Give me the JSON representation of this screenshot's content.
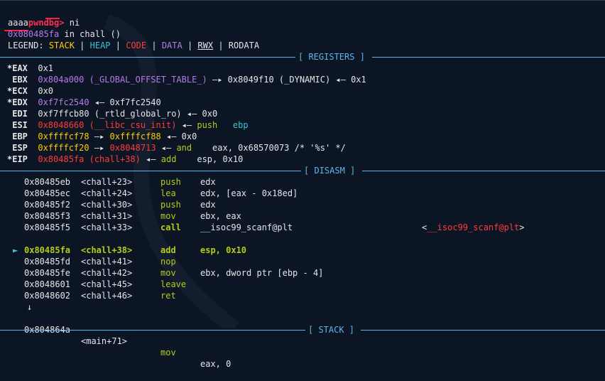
{
  "prompt": "pwndbg>",
  "command": "ni",
  "output_line": "aaaa",
  "location": {
    "addr": "0x080485fa",
    "text": " in chall ()"
  },
  "legend": {
    "label": "LEGEND:",
    "stack": "STACK",
    "heap": "HEAP",
    "code": "CODE",
    "data": "DATA",
    "rwx": "RWX",
    "rodata": "RODATA",
    "sep": " | "
  },
  "sections": {
    "registers": "[ REGISTERS ]",
    "disasm": "[ DISASM ]",
    "stack": "[ STACK ]"
  },
  "registers": [
    {
      "mark": "*",
      "name": "EAX",
      "parts": [
        {
          "t": "0x1",
          "c": "plain"
        }
      ]
    },
    {
      "mark": " ",
      "name": "EBX",
      "parts": [
        {
          "t": "0x804a000 (_GLOBAL_OFFSET_TABLE_)",
          "c": "purple"
        },
        {
          "t": " —▸ 0x8049f10 (_DYNAMIC) ◂— 0x1",
          "c": "plain"
        }
      ]
    },
    {
      "mark": "*",
      "name": "ECX",
      "parts": [
        {
          "t": "0x0",
          "c": "plain"
        }
      ]
    },
    {
      "mark": "*",
      "name": "EDX",
      "parts": [
        {
          "t": "0xf7fc2540",
          "c": "purple"
        },
        {
          "t": " ◂— 0xf7fc2540",
          "c": "plain"
        }
      ]
    },
    {
      "mark": " ",
      "name": "EDI",
      "parts": [
        {
          "t": "0xf7ffcb80 (_rtld_global_ro) ◂— 0x0",
          "c": "plain"
        }
      ]
    },
    {
      "mark": " ",
      "name": "ESI",
      "parts": [
        {
          "t": "0x8048660 (__libc_csu_init)",
          "c": "red"
        },
        {
          "t": " ◂— ",
          "c": "plain"
        },
        {
          "t": "push   ",
          "c": "green"
        },
        {
          "t": "ebp",
          "c": "cyan"
        }
      ]
    },
    {
      "mark": " ",
      "name": "EBP",
      "parts": [
        {
          "t": "0xffffcf78",
          "c": "yellow"
        },
        {
          "t": " —▸ ",
          "c": "plain"
        },
        {
          "t": "0xffffcf88",
          "c": "yellow"
        },
        {
          "t": " ◂— 0x0",
          "c": "plain"
        }
      ]
    },
    {
      "mark": " ",
      "name": "ESP",
      "parts": [
        {
          "t": "0xffffcf20",
          "c": "yellow"
        },
        {
          "t": " —▸ ",
          "c": "plain"
        },
        {
          "t": "0x8048713",
          "c": "red"
        },
        {
          "t": " ◂— ",
          "c": "plain"
        },
        {
          "t": "and    ",
          "c": "green"
        },
        {
          "t": "eax, 0x68570073 /* '%s' */",
          "c": "plain"
        }
      ]
    },
    {
      "mark": "*",
      "name": "EIP",
      "parts": [
        {
          "t": "0x80485fa (chall+38)",
          "c": "red"
        },
        {
          "t": " ◂— ",
          "c": "plain"
        },
        {
          "t": "add    ",
          "c": "green"
        },
        {
          "t": "esp, 0x10",
          "c": "plain"
        }
      ]
    }
  ],
  "disasm": [
    {
      "cur": false,
      "addr": "0x80485eb",
      "sym": "<chall+23>",
      "op": "push",
      "args": "edx",
      "extra": ""
    },
    {
      "cur": false,
      "addr": "0x80485ec",
      "sym": "<chall+24>",
      "op": "lea",
      "args": "edx, [eax - 0x18ed]",
      "extra": ""
    },
    {
      "cur": false,
      "addr": "0x80485f2",
      "sym": "<chall+30>",
      "op": "push",
      "args": "edx",
      "extra": ""
    },
    {
      "cur": false,
      "addr": "0x80485f3",
      "sym": "<chall+31>",
      "op": "mov",
      "args": "ebx, eax",
      "extra": ""
    },
    {
      "cur": false,
      "addr": "0x80485f5",
      "sym": "<chall+33>",
      "op": "call",
      "args": "__isoc99_scanf@plt",
      "extra": "<__isoc99_scanf@plt>"
    },
    {
      "cur": true,
      "addr": "0x80485fa",
      "sym": "<chall+38>",
      "op": "add",
      "args": "esp, 0x10",
      "extra": ""
    },
    {
      "cur": false,
      "addr": "0x80485fd",
      "sym": "<chall+41>",
      "op": "nop",
      "args": "",
      "extra": ""
    },
    {
      "cur": false,
      "addr": "0x80485fe",
      "sym": "<chall+42>",
      "op": "mov",
      "args": "ebx, dword ptr [ebp - 4]",
      "extra": ""
    },
    {
      "cur": false,
      "addr": "0x8048601",
      "sym": "<chall+45>",
      "op": "leave",
      "args": "",
      "extra": ""
    },
    {
      "cur": false,
      "addr": "0x8048602",
      "sym": "<chall+46>",
      "op": "ret",
      "args": "",
      "extra": ""
    }
  ],
  "down_arrow": "↓",
  "after": {
    "addr": "0x804864a",
    "sym": "<main+71>",
    "op": "mov",
    "args": "eax, 0"
  },
  "current_marker": "►",
  "colors": {
    "bg": "#0c1524",
    "prompt": "#ff2f4f",
    "rule": "#5fb5e8",
    "current": "#b5cc18"
  }
}
